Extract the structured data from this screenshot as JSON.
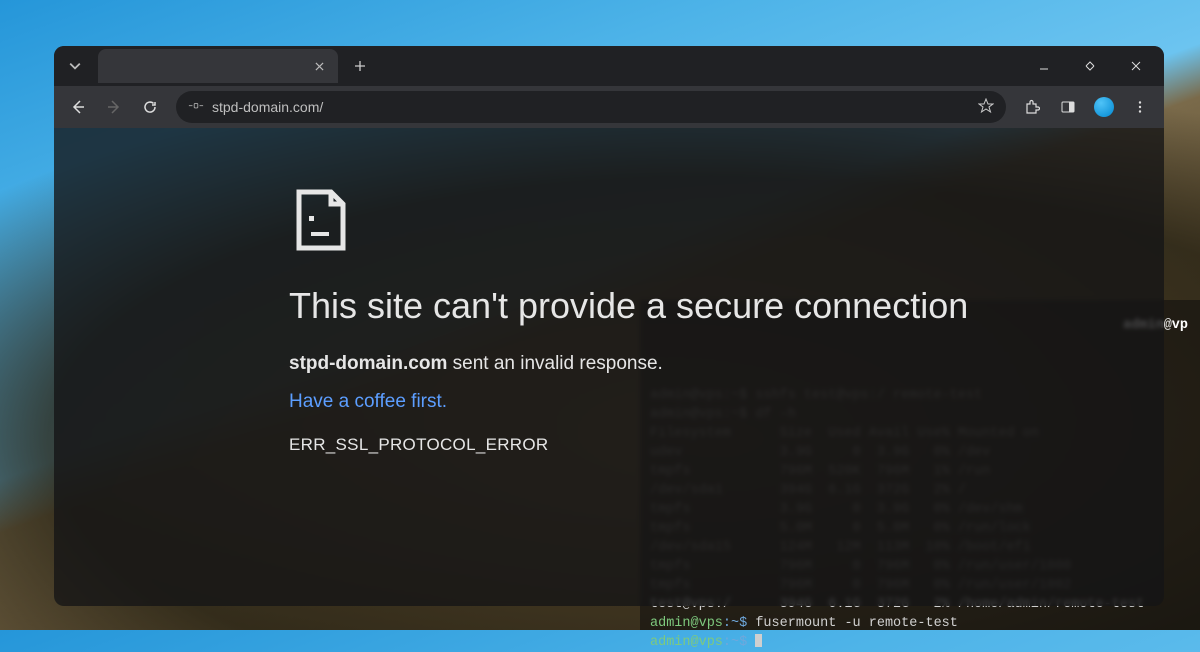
{
  "browser": {
    "address_url": "stpd-domain.com/"
  },
  "error": {
    "title": "This site can't provide a secure connection",
    "domain": "stpd-domain.com",
    "message_suffix": " sent an invalid response.",
    "link_text": "Have a coffee first.",
    "error_code": "ERR_SSL_PROTOCOL_ERROR"
  },
  "terminal": {
    "title_user": "admin",
    "title_sep": "@",
    "title_host": "vp",
    "cmd1_prompt": "admin@vps:~$ ",
    "cmd1": "sshfs test@vps:/ remote-test",
    "cmd2_prompt": "admin@vps:~$ ",
    "cmd2": "df -h",
    "header": "Filesystem      Size  Used Avail Use% Mounted on",
    "rows": [
      "udev            3.9G     0  3.9G   0% /dev",
      "tmpfs           796M  520K  796M   1% /run",
      "/dev/sda1       394G  6.1G  372G   2% /",
      "tmpfs           3.9G     0  3.9G   0% /dev/shm",
      "tmpfs           5.0M     0  5.0M   0% /run/lock",
      "/dev/sda15      124M   12M  113M  10% /boot/efi",
      "tmpfs           796M     0  796M   0% /run/user/1000",
      "tmpfs           796M     0  796M   0% /run/user/1002"
    ],
    "bright_row": "test@vps:/      394G  6.1G  372G   2% /home/admin/remote-test",
    "cmd3_user": "admin@vps",
    "cmd3_path": ":~$",
    "cmd3": " fusermount -u remote-test",
    "cmd4_user": "admin@vps",
    "cmd4_path": ":~$"
  }
}
